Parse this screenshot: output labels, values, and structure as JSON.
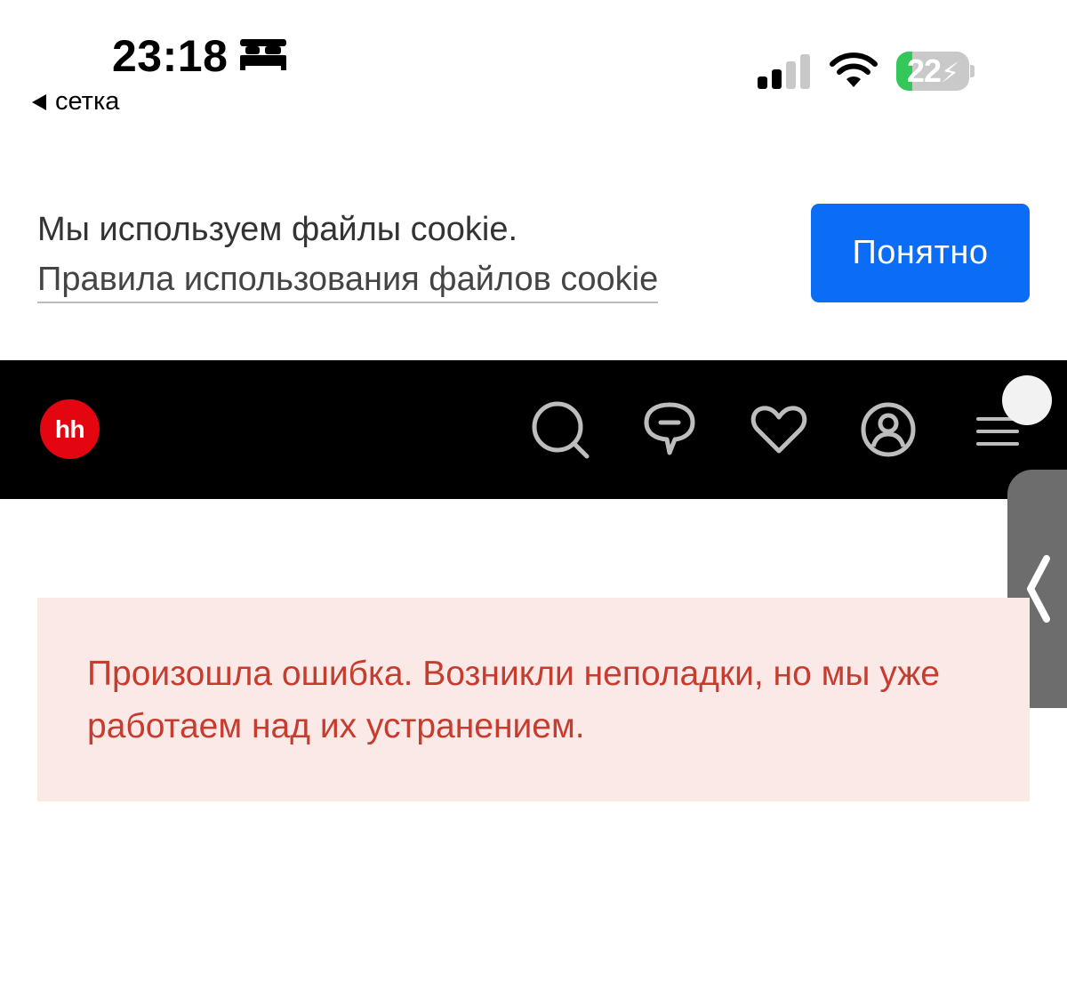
{
  "status_bar": {
    "time": "23:18",
    "back_app": "сетка",
    "battery_level": "22",
    "battery_percent": 22
  },
  "cookie_banner": {
    "message": "Мы используем файлы cookie.",
    "link_text": "Правила использования файлов cookie",
    "accept_label": "Понятно"
  },
  "header": {
    "logo_text": "hh",
    "icons": [
      "search-icon",
      "chat-icon",
      "heart-icon",
      "profile-icon",
      "menu-icon"
    ]
  },
  "error": {
    "message": "Произошла ошибка. Возникли неполадки, но мы уже работаем над их устранением."
  },
  "colors": {
    "accent_button": "#0b6cf5",
    "brand_red": "#e30611",
    "error_text": "#c63d2f",
    "error_bg": "#fbe9e7",
    "header_bg": "#000000"
  }
}
